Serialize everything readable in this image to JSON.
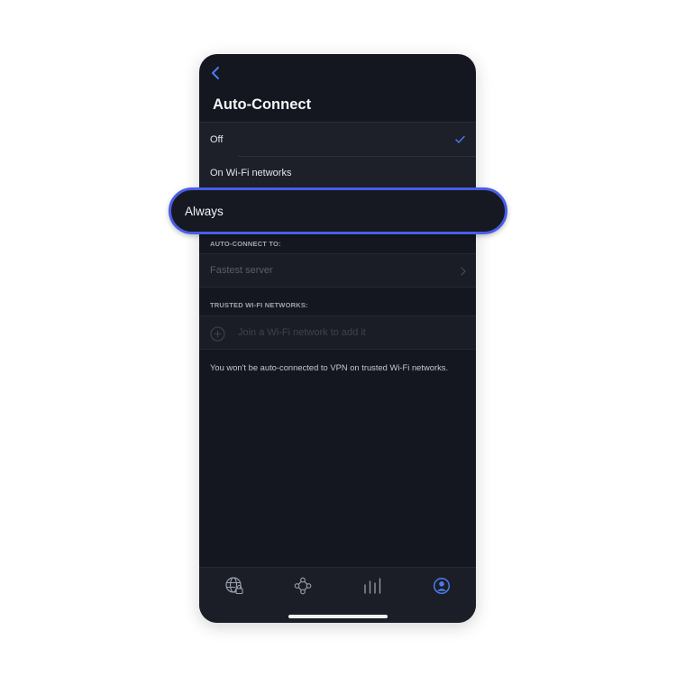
{
  "header": {
    "back_icon": "chevron-left-icon",
    "title": "Auto-Connect"
  },
  "options": {
    "off": {
      "label": "Off",
      "selected": true
    },
    "wifi": {
      "label": "On Wi-Fi networks",
      "selected": false
    },
    "always": {
      "label": "Always",
      "selected": false
    }
  },
  "auto_connect_section": {
    "heading": "AUTO-CONNECT TO:",
    "server_label": "Fastest server"
  },
  "trusted_section": {
    "heading": "TRUSTED WI-FI NETWORKS:",
    "join_label": "Join a Wi-Fi network to add it"
  },
  "note": "You won't be auto-connected to VPN on trusted Wi-Fi networks.",
  "tabs": [
    {
      "icon": "globe-lock-icon"
    },
    {
      "icon": "nodes-icon"
    },
    {
      "icon": "bars-icon"
    },
    {
      "icon": "profile-icon",
      "active": true
    }
  ],
  "colors": {
    "accent": "#4a7cf0",
    "background": "#141720",
    "highlight_border": "#4a5de8"
  }
}
